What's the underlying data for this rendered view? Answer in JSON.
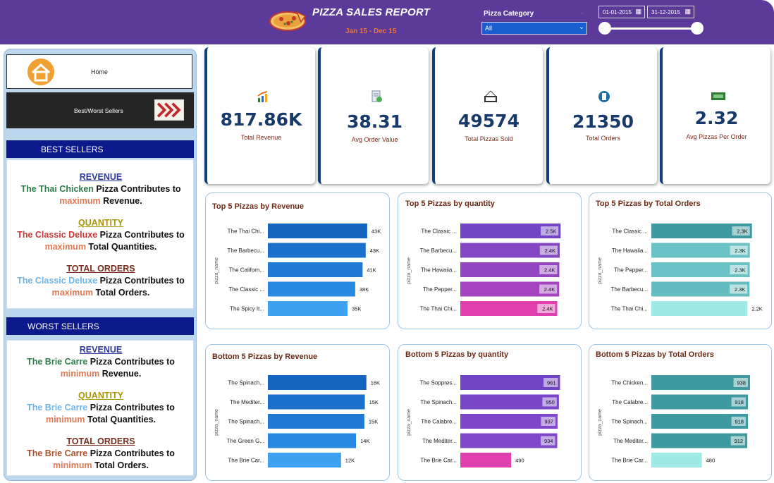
{
  "header": {
    "title": "PIZZA SALES REPORT",
    "subtitle": "Jan 15 - Dec 15",
    "category_label": "Pizza Category",
    "category_value": "All",
    "date_start": "01-01-2015",
    "date_end": "31-12-2015"
  },
  "nav": {
    "home_label": "Home",
    "bw_label": "Best/Worst Sellers"
  },
  "best": {
    "heading": "BEST SELLERS",
    "revenue": {
      "head": "REVENUE",
      "pizza": "The Thai Chicken",
      "mid": " Pizza Contributes to",
      "adj": "maximum",
      "metric": " Revenue."
    },
    "quantity": {
      "head": "QUANTITY",
      "pizza": "The Classic Deluxe",
      "mid": " Pizza Contributes to",
      "adj": "maximum",
      "metric": " Total Quantities."
    },
    "orders": {
      "head": "TOTAL ORDERS",
      "pizza": "The Classic Deluxe",
      "mid": " Pizza Contributes to",
      "adj": "maximum",
      "metric": " Total Orders."
    }
  },
  "worst": {
    "heading": "WORST SELLERS",
    "revenue": {
      "head": "REVENUE",
      "pizza": "The Brie Carre",
      "mid": " Pizza Contributes to",
      "adj": "minimum",
      "metric": " Revenue."
    },
    "quantity": {
      "head": "QUANTITY",
      "pizza": "The Brie Carre",
      "mid": " Pizza Contributes to",
      "adj": "minimum",
      "metric": " Total Quantities."
    },
    "orders": {
      "head": "TOTAL ORDERS",
      "pizza": "The Brie Carre",
      "mid": " Pizza Contributes to",
      "adj": "minimum",
      "metric": " Total Orders."
    }
  },
  "kpis": [
    {
      "value": "817.86K",
      "label": "Total Revenue",
      "icon": "chart-growth-icon"
    },
    {
      "value": "38.31",
      "label": "Avg Order Value",
      "icon": "document-check-icon"
    },
    {
      "value": "49574",
      "label": "Total Pizzas Sold",
      "icon": "sold-sign-icon"
    },
    {
      "value": "21350",
      "label": "Total Orders",
      "icon": "receipt-icon"
    },
    {
      "value": "2.32",
      "label": "Avg Pizzas Per Order",
      "icon": "money-hand-icon"
    }
  ],
  "colors": {
    "header_bg": "#5b3a9a",
    "kpi_value": "#173a6a",
    "accent_orange": "#e8753a"
  },
  "chart_data": [
    {
      "type": "bar",
      "orientation": "horizontal",
      "title": "Top 5 Pizzas by Revenue",
      "ylabel": "pizza_name",
      "categories": [
        "The Thai Chi...",
        "The Barbecu...",
        "The Californ...",
        "The Classic ...",
        "The Spicy It..."
      ],
      "values": [
        43.43,
        42.77,
        41.41,
        38.18,
        34.83
      ],
      "labels": [
        "43K",
        "43K",
        "41K",
        "38K",
        "35K"
      ],
      "xlim": [
        0,
        45
      ],
      "colors": [
        "#1565c0",
        "#1a70cc",
        "#1f7ad6",
        "#2889e2",
        "#3fa1f2"
      ]
    },
    {
      "type": "bar",
      "orientation": "horizontal",
      "title": "Top 5 Pizzas by quantity",
      "ylabel": "pizza_name",
      "categories": [
        "The Classic ...",
        "The Barbecu...",
        "The Hawaiia...",
        "The Pepper...",
        "The Thai Chi..."
      ],
      "values": [
        2453,
        2432,
        2422,
        2418,
        2371
      ],
      "labels": [
        "2.5K",
        "2.4K",
        "2.4K",
        "2.4K",
        "2.4K"
      ],
      "xlim": [
        0,
        2500
      ],
      "colors": [
        "#7244c4",
        "#8447c4",
        "#9446c2",
        "#a343bd",
        "#e03fae"
      ]
    },
    {
      "type": "bar",
      "orientation": "horizontal",
      "title": "Top 5 Pizzas by Total Orders",
      "ylabel": "pizza_name",
      "categories": [
        "The Classic ...",
        "The Hawaiia...",
        "The Pepper...",
        "The Barbecu...",
        "The Thai Chi..."
      ],
      "values": [
        2329,
        2280,
        2278,
        2273,
        2225
      ],
      "labels": [
        "2.3K",
        "2.3K",
        "2.3K",
        "2.3K",
        "2.2K"
      ],
      "xlim": [
        0,
        2350
      ],
      "colors": [
        "#3e9aa0",
        "#6ac2c4",
        "#6ac2c4",
        "#64bcbf",
        "#9feae6"
      ]
    },
    {
      "type": "bar",
      "orientation": "horizontal",
      "title": "Bottom 5 Pizzas by Revenue",
      "ylabel": "pizza_name",
      "categories": [
        "The Spinach...",
        "The Mediter...",
        "The Spinach...",
        "The Green G...",
        "The Brie Car..."
      ],
      "values": [
        15.6,
        15.36,
        15.28,
        13.96,
        11.59
      ],
      "labels": [
        "16K",
        "15K",
        "15K",
        "14K",
        "12K"
      ],
      "xlim": [
        0,
        16.3
      ],
      "colors": [
        "#1565c0",
        "#1a70cc",
        "#1f7ad6",
        "#2889e2",
        "#3fa1f2"
      ]
    },
    {
      "type": "bar",
      "orientation": "horizontal",
      "title": "Bottom 5 Pizzas by quantity",
      "ylabel": "pizza_name",
      "categories": [
        "The Soppres...",
        "The Spinach...",
        "The Calabre...",
        "The Mediter...",
        "The Brie Car..."
      ],
      "values": [
        961,
        950,
        937,
        934,
        490
      ],
      "labels": [
        "961",
        "950",
        "937",
        "934",
        "490"
      ],
      "xlim": [
        0,
        985
      ],
      "colors": [
        "#7244c4",
        "#7a46c8",
        "#7e47c9",
        "#7f48ca",
        "#e03fae"
      ]
    },
    {
      "type": "bar",
      "orientation": "horizontal",
      "title": "Bottom 5 Pizzas by Total Orders",
      "ylabel": "pizza_name",
      "categories": [
        "The Chicken...",
        "The Calabre...",
        "The Spinach...",
        "The Mediter...",
        "The Brie Car..."
      ],
      "values": [
        938,
        918,
        918,
        912,
        480
      ],
      "labels": [
        "938",
        "918",
        "918",
        "912",
        "480"
      ],
      "xlim": [
        0,
        965
      ],
      "colors": [
        "#3e9aa0",
        "#3e9aa0",
        "#3e9aa0",
        "#3e9aa0",
        "#9feae6"
      ]
    }
  ]
}
